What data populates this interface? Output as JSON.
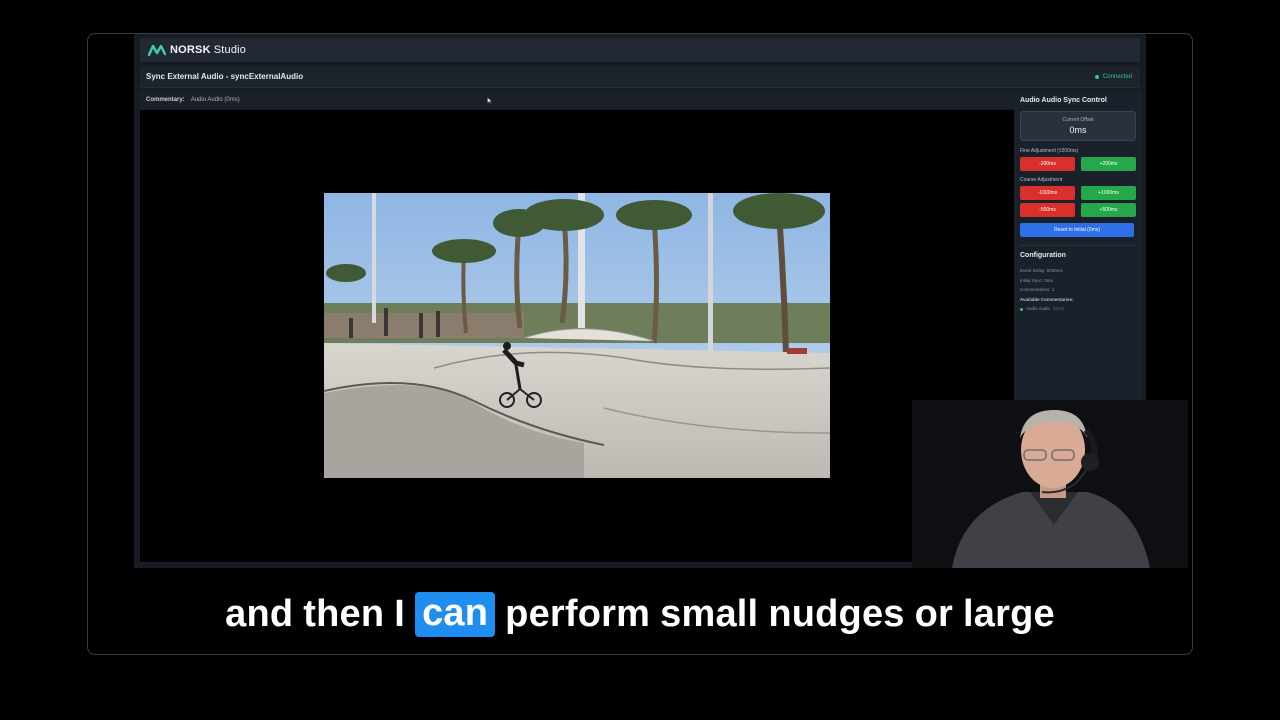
{
  "app": {
    "brand": "NORSK",
    "brand_suffix": "Studio",
    "page_title": "Sync External Audio - syncExternalAudio",
    "connection_status": "Connected",
    "colors": {
      "accent_green": "#34c38f",
      "button_red": "#d9302c",
      "button_green": "#25a84a",
      "button_blue": "#2f6fe8",
      "caption_highlight": "#1f8ef1"
    }
  },
  "commentary_bar": {
    "label": "Commentary:",
    "value": "Audio Audio (0ms)"
  },
  "sync_panel": {
    "title": "Audio Audio Sync Control",
    "current_offset_label": "Current Offset",
    "current_offset_value": "0ms",
    "fine_label": "Fine Adjustment (±200ms)",
    "fine_buttons": [
      "-200ms",
      "+200ms"
    ],
    "coarse_label": "Coarse Adjustment",
    "coarse_buttons": [
      [
        "-1000ms",
        "+1000ms"
      ],
      [
        "-500ms",
        "+500ms"
      ]
    ],
    "reset_label": "Reset to Initial (0ms)"
  },
  "configuration": {
    "title": "Configuration",
    "lines": [
      "Event Delay: 5000ms",
      "Initial Sync: 0ms",
      "Commentaries: 1"
    ],
    "available_label": "Available Commentaries:",
    "items": [
      {
        "name": "Audio Audio",
        "offset": "(0ms)"
      }
    ]
  },
  "caption": {
    "words": [
      "and",
      "then",
      "I",
      "can",
      "perform",
      "small",
      "nudges",
      "or",
      "large"
    ],
    "highlighted_word": "can"
  }
}
